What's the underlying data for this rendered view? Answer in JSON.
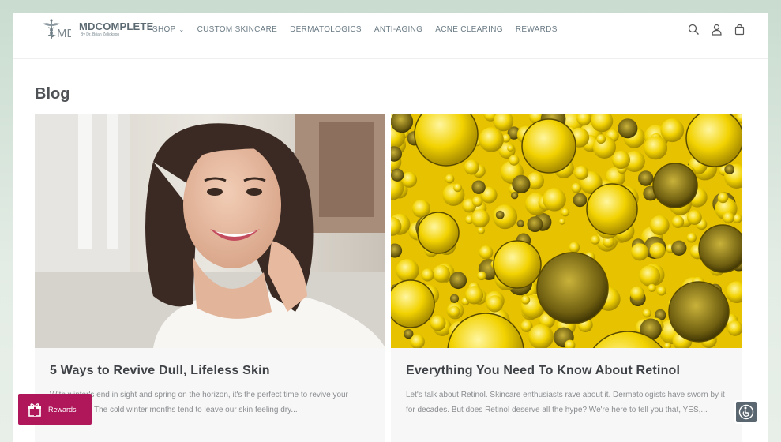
{
  "brand": {
    "name": "MDCOMPLETE",
    "tagline": "By Dr. Brian Zelickson"
  },
  "nav": {
    "items": [
      {
        "label": "SHOP",
        "has_dropdown": true
      },
      {
        "label": "CUSTOM SKINCARE"
      },
      {
        "label": "DERMATOLOGICS"
      },
      {
        "label": "ANTI-AGING"
      },
      {
        "label": "ACNE CLEARING"
      },
      {
        "label": "REWARDS"
      }
    ],
    "icons": [
      "search-icon",
      "account-icon",
      "cart-icon"
    ]
  },
  "page": {
    "title": "Blog"
  },
  "posts": [
    {
      "title": "5 Ways to Revive Dull, Lifeless Skin",
      "excerpt": "With winter's end in sight and spring on the horizon, it's the perfect time to revive your complexion. The cold winter months tend to leave our skin feeling dry...",
      "image": "smiling-woman-photo"
    },
    {
      "title": "Everything You Need To Know About Retinol",
      "excerpt": "Let's talk about Retinol. Skincare enthusiasts rave about it. Dermatologists have sworn by it for decades. But does Retinol deserve all the hype? We're here to tell you that, YES,...",
      "image": "oil-bubbles-photo"
    }
  ],
  "rewards_widget": {
    "label": "Rewards",
    "color": "#b0175b",
    "icon": "gift-icon"
  },
  "accessibility": {
    "icon": "accessibility-icon"
  },
  "colors": {
    "text_primary": "#3f4246",
    "text_muted": "#8a8d90",
    "accent": "#b0175b"
  }
}
